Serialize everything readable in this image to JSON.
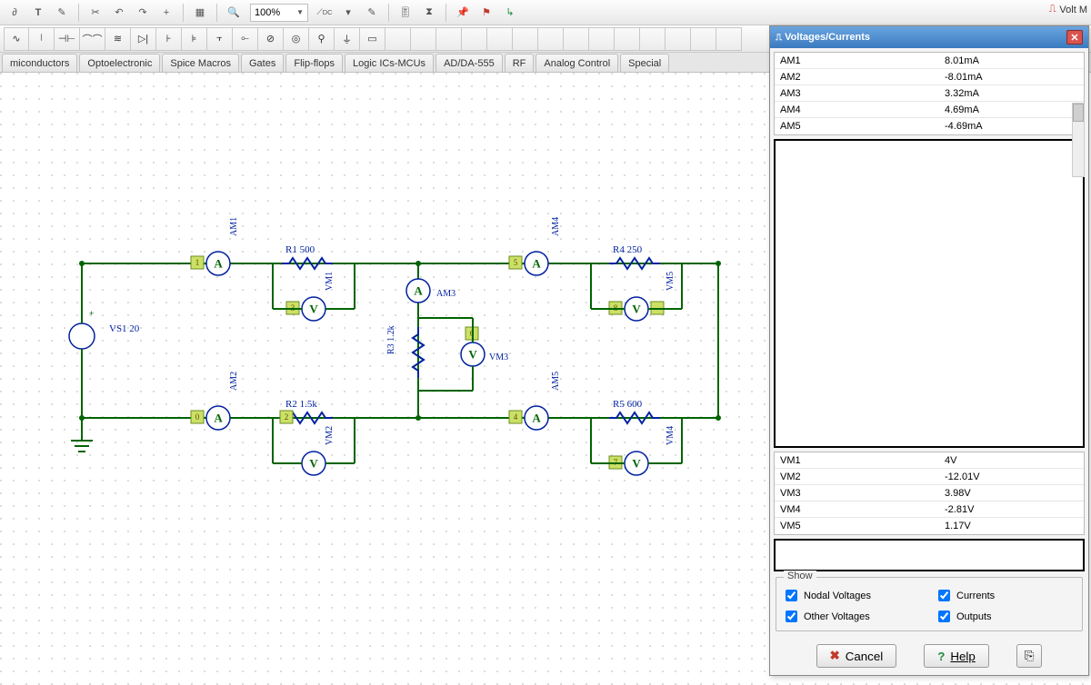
{
  "zoom": "100%",
  "app_label": "Volt M",
  "tabs": [
    "miconductors",
    "Optoelectronic",
    "Spice Macros",
    "Gates",
    "Flip-flops",
    "Logic ICs-MCUs",
    "AD/DA-555",
    "RF",
    "Analog Control",
    "Special"
  ],
  "schematic": {
    "vs": "VS1 20",
    "r1": "R1 500",
    "r2": "R2 1.5k",
    "r3": "R3 1.2k",
    "r4": "R4 250",
    "r5": "R5 600",
    "am3": "AM3",
    "vm3": "VM3",
    "am1": "AM1",
    "am2": "AM2",
    "am4": "AM4",
    "am5": "AM5",
    "vm1": "VM1",
    "vm2": "VM2",
    "vm4": "VM4",
    "vm5": "VM5"
  },
  "panel": {
    "title": "Voltages/Currents",
    "currents": [
      {
        "name": "AM1",
        "value": "8.01mA"
      },
      {
        "name": "AM2",
        "value": "-8.01mA"
      },
      {
        "name": "AM3",
        "value": "3.32mA"
      },
      {
        "name": "AM4",
        "value": "4.69mA"
      },
      {
        "name": "AM5",
        "value": "-4.69mA"
      }
    ],
    "voltages": [
      {
        "name": "VM1",
        "value": "4V"
      },
      {
        "name": "VM2",
        "value": "-12.01V"
      },
      {
        "name": "VM3",
        "value": "3.98V"
      },
      {
        "name": "VM4",
        "value": "-2.81V"
      },
      {
        "name": "VM5",
        "value": "1.17V"
      }
    ],
    "show_label": "Show",
    "chk_nodal": "Nodal Voltages",
    "chk_other": "Other Voltages",
    "chk_currents": "Currents",
    "chk_outputs": "Outputs",
    "btn_cancel": "Cancel",
    "btn_help": "Help"
  }
}
